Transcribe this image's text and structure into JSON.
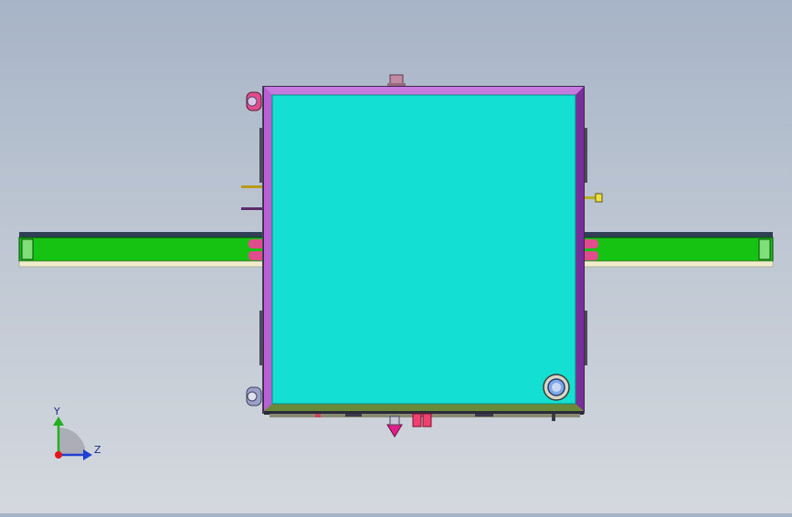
{
  "viewport": {
    "background_top": "#a7b4c7",
    "background_bottom": "#d4d8de"
  },
  "model": {
    "panel_face_color": "#13e0d2",
    "frame_color": "#a84cc7",
    "rail_color": "#16c212",
    "rail_edge_color": "#2f3f55",
    "rail_base_color": "#efeccc",
    "roller_color": "#e04c8c",
    "indicator_color": "#f04070",
    "bolt_color": "#d7d7c5"
  },
  "triad": {
    "y_label": "Y",
    "z_label": "Z",
    "y_color": "#22b022",
    "z_color": "#1f3fd0",
    "origin_color": "#e01818"
  }
}
